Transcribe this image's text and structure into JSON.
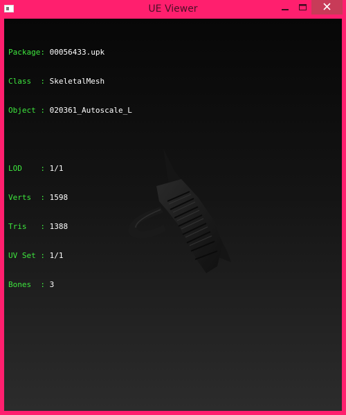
{
  "window": {
    "title": "UE Viewer",
    "controls": {
      "minimize_icon": "minimize-icon",
      "maximize_icon": "maximize-icon",
      "close_icon": "close-icon"
    },
    "frame_color": "#ff1f6e"
  },
  "info_panel": {
    "rows": [
      {
        "key": "Package:",
        "value": "00056433.upk"
      },
      {
        "key": "Class  :",
        "value": "SkeletalMesh"
      },
      {
        "key": "Object :",
        "value": "020361_Autoscale_L"
      },
      {
        "key": "",
        "value": ""
      },
      {
        "key": "LOD    :",
        "value": "1/1"
      },
      {
        "key": "Verts  :",
        "value": "1598"
      },
      {
        "key": "Tris   :",
        "value": "1388"
      },
      {
        "key": "UV Set :",
        "value": "1/1"
      },
      {
        "key": "Bones  :",
        "value": "3"
      }
    ],
    "key_color": "#3ee83e",
    "value_color": "#ffffff"
  },
  "viewport": {
    "background_top": "#070707",
    "background_bottom": "#2c2c2c",
    "model_icon": "skeletal-mesh-model"
  }
}
